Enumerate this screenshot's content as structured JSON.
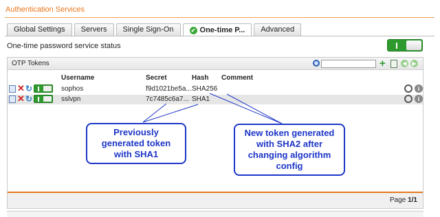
{
  "header": {
    "title": "Authentication Services"
  },
  "tabs": [
    {
      "label": "Global Settings",
      "active": false
    },
    {
      "label": "Servers",
      "active": false
    },
    {
      "label": "Single Sign-On",
      "active": false
    },
    {
      "label": "One-time P...",
      "active": true
    },
    {
      "label": "Advanced",
      "active": false
    }
  ],
  "service": {
    "status_label": "One-time password service status",
    "enabled": true
  },
  "panel": {
    "title": "OTP Tokens",
    "search": {
      "value": "",
      "placeholder": ""
    },
    "columns": {
      "username": "Username",
      "secret": "Secret",
      "hash": "Hash",
      "comment": "Comment"
    },
    "rows": [
      {
        "username": "sophos",
        "secret": "f9d1021be5a...",
        "hash": "SHA256",
        "comment": ""
      },
      {
        "username": "sslvpn",
        "secret": "7c7485c6a7...",
        "hash": "SHA1",
        "comment": ""
      }
    ],
    "pager": {
      "label": "Page",
      "value": "1/1"
    }
  },
  "callouts": {
    "left": "Previously generated token with SHA1",
    "right": "New token generated with SHA2 after changing algorithm config"
  },
  "colors": {
    "accent": "#e8751a",
    "toggle_on": "#2e9a2e",
    "callout": "#1c35c7"
  }
}
